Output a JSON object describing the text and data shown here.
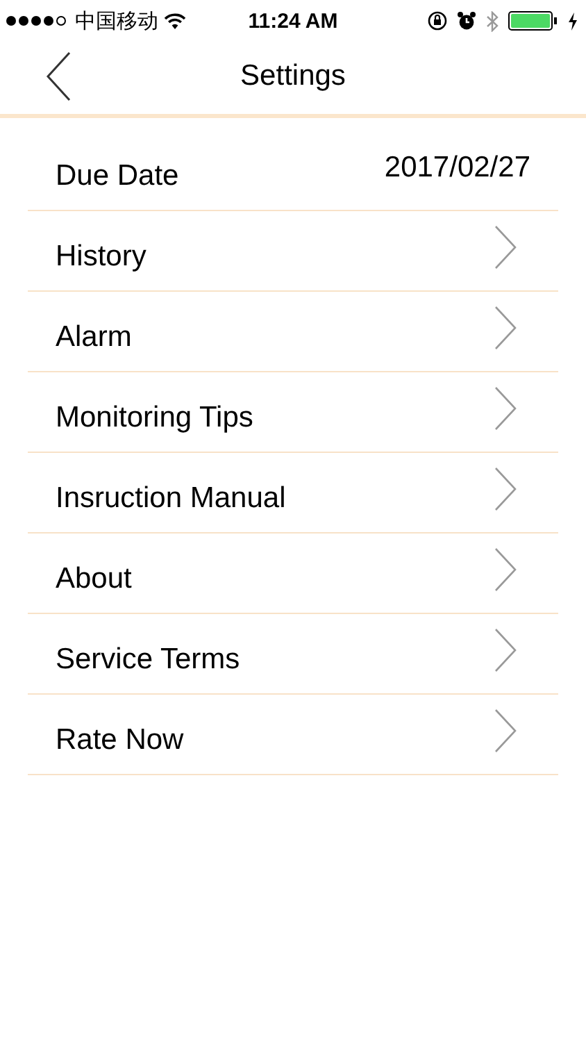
{
  "status_bar": {
    "carrier": "中国移动",
    "time": "11:24 AM"
  },
  "nav": {
    "title": "Settings"
  },
  "rows": [
    {
      "kind": "value",
      "label": "Due Date",
      "value": "2017/02/27"
    },
    {
      "kind": "link",
      "label": "History"
    },
    {
      "kind": "link",
      "label": "Alarm"
    },
    {
      "kind": "link",
      "label": "Monitoring Tips"
    },
    {
      "kind": "link",
      "label": "Insruction Manual"
    },
    {
      "kind": "link",
      "label": "About"
    },
    {
      "kind": "link",
      "label": "Service Terms"
    },
    {
      "kind": "link",
      "label": "Rate Now"
    }
  ]
}
